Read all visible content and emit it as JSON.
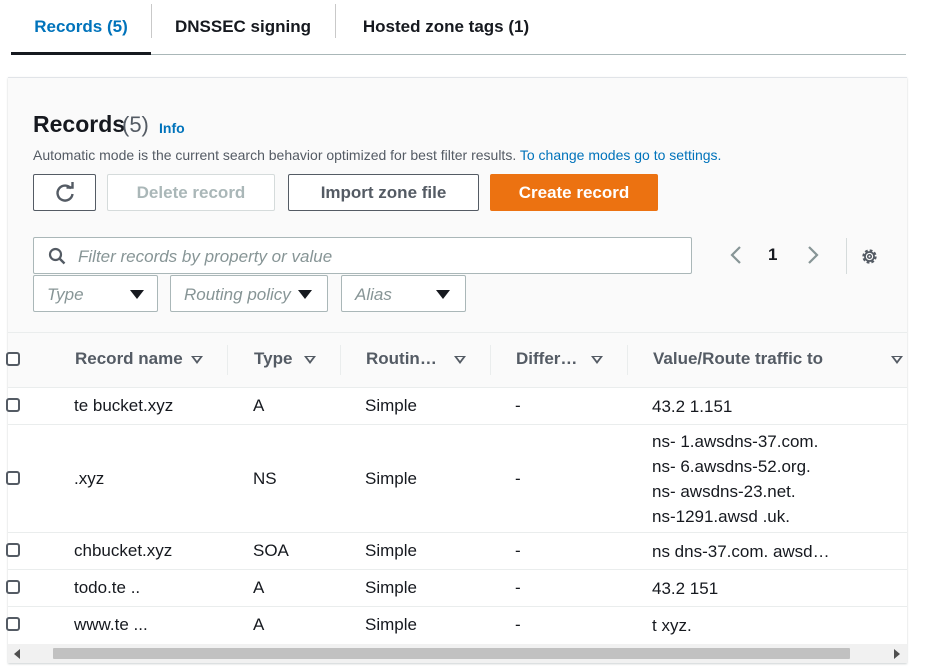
{
  "tabs": [
    {
      "label": "Records (5)"
    },
    {
      "label": "DNSSEC signing"
    },
    {
      "label": "Hosted zone tags (1)"
    }
  ],
  "header": {
    "title": "Records",
    "count": "(5)",
    "info": "Info",
    "description": "Automatic mode is the current search behavior optimized for best filter results.",
    "settings_link": "To change modes go to settings."
  },
  "actions": {
    "refresh_icon": "refresh-icon",
    "delete": "Delete record",
    "import": "Import zone file",
    "create": "Create record"
  },
  "filter": {
    "placeholder": "Filter records by property or value",
    "type": "Type",
    "routing": "Routing policy",
    "alias": "Alias"
  },
  "pagination": {
    "current": "1"
  },
  "columns": [
    "Record name",
    "Type",
    "Routin…",
    "Differ…",
    "Value/Route traffic to"
  ],
  "rows": [
    {
      "name": "te  bucket.xyz",
      "type": "A",
      "routing": "Simple",
      "diff": "-",
      "values": [
        "43.2     1.151"
      ]
    },
    {
      "name": "      .xyz",
      "type": "NS",
      "routing": "Simple",
      "diff": "-",
      "values": [
        "ns-   1.awsdns-37.com.",
        "ns-    6.awsdns-52.org.",
        "ns-   awsdns-23.net.",
        "ns-1291.awsd       .uk."
      ]
    },
    {
      "name": "  chbucket.xyz",
      "type": "SOA",
      "routing": "Simple",
      "diff": "-",
      "values": [
        "ns    dns-37.com. awsd…"
      ]
    },
    {
      "name": "todo.te    ..",
      "type": "A",
      "routing": "Simple",
      "diff": "-",
      "values": [
        "43.2         151"
      ]
    },
    {
      "name": "www.te     ...",
      "type": "A",
      "routing": "Simple",
      "diff": "-",
      "values": [
        "t         xyz."
      ]
    }
  ],
  "colors": {
    "accent": "#0073bb",
    "primary_button": "#ec7211"
  }
}
